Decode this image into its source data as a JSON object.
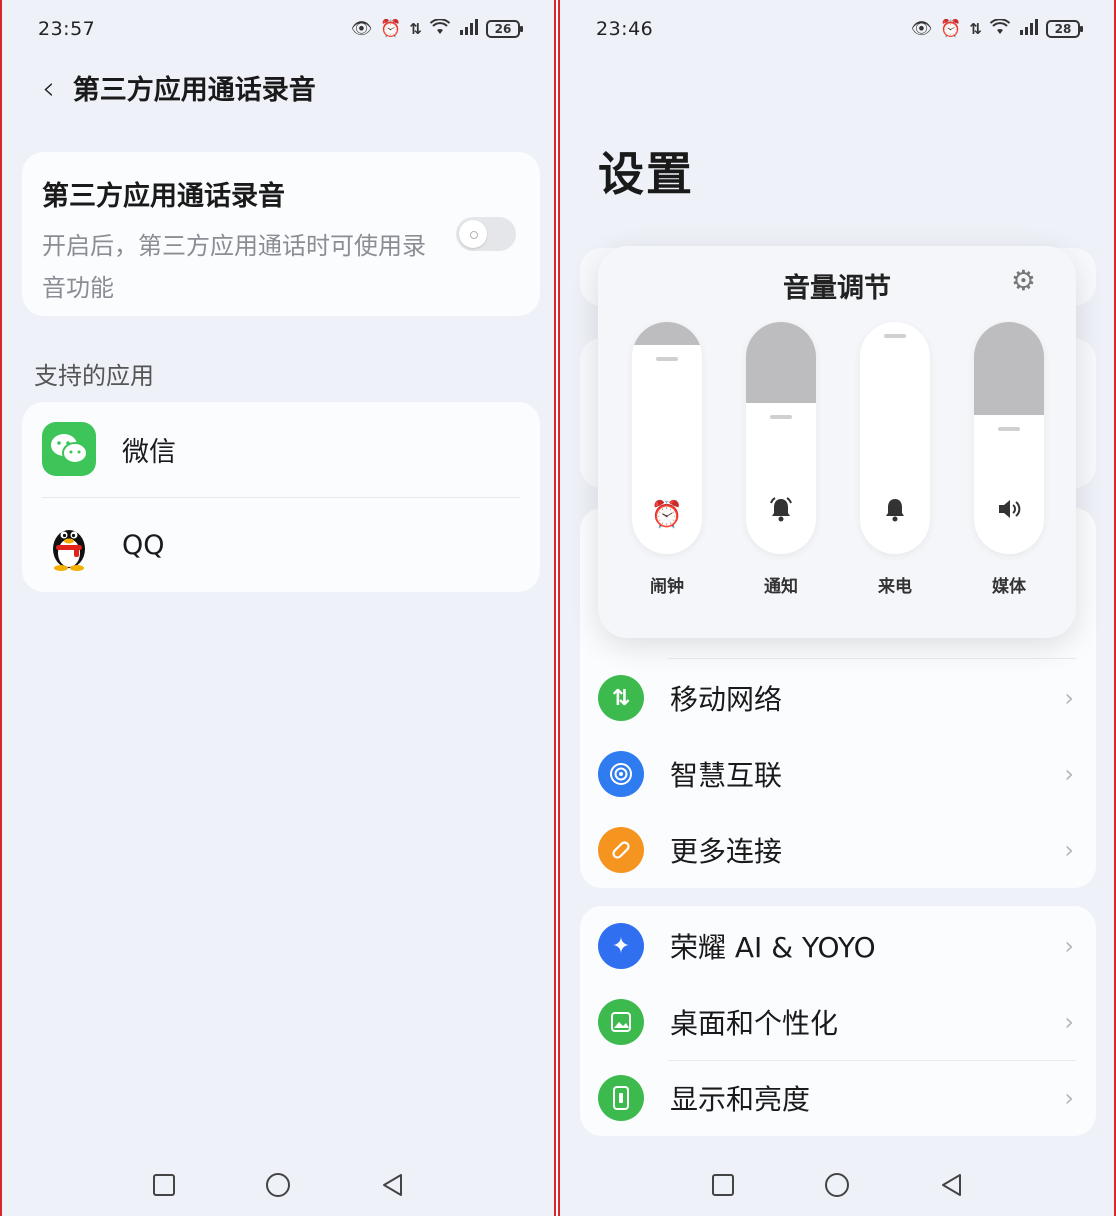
{
  "left": {
    "status": {
      "time": "23:57",
      "battery": "26"
    },
    "header": {
      "title": "第三方应用通话录音"
    },
    "toggle": {
      "title": "第三方应用通话录音",
      "description": "开启后，第三方应用通话时可使用录音功能",
      "enabled": false
    },
    "section_label": "支持的应用",
    "apps": [
      {
        "name": "微信",
        "icon": "wechat-icon"
      },
      {
        "name": "QQ",
        "icon": "qq-penguin-icon"
      }
    ]
  },
  "right": {
    "status": {
      "time": "23:46",
      "battery": "28"
    },
    "title": "设置",
    "volume_panel": {
      "title": "音量调节",
      "sliders": [
        {
          "label": "闹钟",
          "icon": "alarm-clock-icon",
          "level": 0.9
        },
        {
          "label": "通知",
          "icon": "notification-bell-icon",
          "level": 0.65
        },
        {
          "label": "来电",
          "icon": "ringtone-bell-icon",
          "level": 1.0
        },
        {
          "label": "媒体",
          "icon": "speaker-icon",
          "level": 0.6
        }
      ]
    },
    "menu_group_1": [
      {
        "label": "移动网络",
        "icon": "mobile-network-icon",
        "color": "#3dba4e"
      },
      {
        "label": "智慧互联",
        "icon": "smart-connect-icon",
        "color": "#2f7bf0"
      },
      {
        "label": "更多连接",
        "icon": "link-icon",
        "color": "#f5941e"
      }
    ],
    "menu_group_2": [
      {
        "label": "荣耀 AI & YOYO",
        "icon": "ai-sparkle-icon",
        "color": "#2f6ff0"
      },
      {
        "label": "桌面和个性化",
        "icon": "wallpaper-icon",
        "color": "#3dba4e"
      },
      {
        "label": "显示和亮度",
        "icon": "display-icon",
        "color": "#3dba4e"
      }
    ]
  },
  "colors": {
    "frame_border": "#d9262c",
    "background": "#eef1f7",
    "wechat_green": "#3ec55a"
  }
}
